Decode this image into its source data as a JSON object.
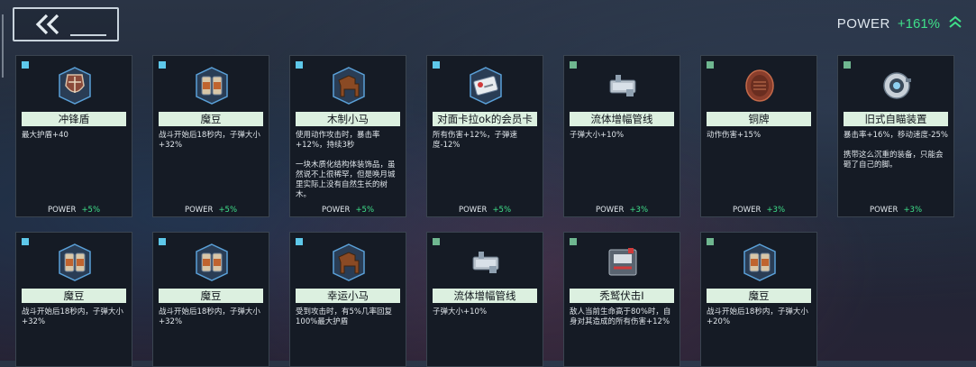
{
  "header": {
    "power_label": "POWER",
    "power_value": "+161%"
  },
  "colors": {
    "rarity_blue": "#5ec8ea",
    "rarity_green": "#6fb790",
    "power_green": "#3fe08a",
    "title_bg": "#dcf0e0"
  },
  "cards": [
    {
      "rarity": "blue",
      "icon": "shield-icon",
      "title": "冲锋盾",
      "desc": "最大护盾+40",
      "power_label": "POWER",
      "power_value": "+5%"
    },
    {
      "rarity": "blue",
      "icon": "bean-can-icon",
      "title": "魔豆",
      "desc": "战斗开始后18秒内，子弹大小+32%",
      "power_label": "POWER",
      "power_value": "+5%"
    },
    {
      "rarity": "blue",
      "icon": "wooden-horse-icon",
      "title": "木制小马",
      "desc": "使用动作攻击时，暴击率+12%，持续3秒\n\n一块木质化结构体装饰品，虽然说不上很稀罕，但是唤月城里实际上没有自然生长的树木。",
      "power_label": "POWER",
      "power_value": "+5%"
    },
    {
      "rarity": "blue",
      "icon": "membership-card-icon",
      "title": "对面卡拉ok的会员卡",
      "desc": "所有伤害+12%，子弹速度-12%",
      "power_label": "POWER",
      "power_value": "+5%"
    },
    {
      "rarity": "green",
      "icon": "pipeline-icon",
      "title": "流体增幅管线",
      "desc": "子弹大小+10%",
      "power_label": "POWER",
      "power_value": "+3%"
    },
    {
      "rarity": "green",
      "icon": "copper-plate-icon",
      "title": "铜牌",
      "desc": "动作伤害+15%",
      "power_label": "POWER",
      "power_value": "+3%"
    },
    {
      "rarity": "green",
      "icon": "aim-device-icon",
      "title": "旧式自瞄装置",
      "desc": "暴击率+16%，移动速度-25%\n\n携带这么沉重的装备，只能会砸了自己的脚。",
      "power_label": "POWER",
      "power_value": "+3%"
    },
    {
      "rarity": "blue",
      "icon": "bean-can-icon",
      "title": "魔豆",
      "desc": "战斗开始后18秒内，子弹大小+32%",
      "power_label": "",
      "power_value": ""
    },
    {
      "rarity": "blue",
      "icon": "bean-can-icon",
      "title": "魔豆",
      "desc": "战斗开始后18秒内，子弹大小+32%",
      "power_label": "",
      "power_value": ""
    },
    {
      "rarity": "blue",
      "icon": "wooden-horse-icon",
      "title": "幸运小马",
      "desc": "受到攻击时，有5%几率回复100%最大护盾",
      "power_label": "",
      "power_value": ""
    },
    {
      "rarity": "green",
      "icon": "pipeline-icon",
      "title": "流体增幅管线",
      "desc": "子弹大小+10%",
      "power_label": "",
      "power_value": ""
    },
    {
      "rarity": "green",
      "icon": "vulture-strike-icon",
      "title": "秃鹫伏击I",
      "desc": "敌人当前生命高于80%时，自身对其造成的所有伤害+12%",
      "power_label": "",
      "power_value": ""
    },
    {
      "rarity": "green",
      "icon": "bean-can-icon",
      "title": "魔豆",
      "desc": "战斗开始后18秒内，子弹大小+20%",
      "power_label": "",
      "power_value": ""
    }
  ]
}
